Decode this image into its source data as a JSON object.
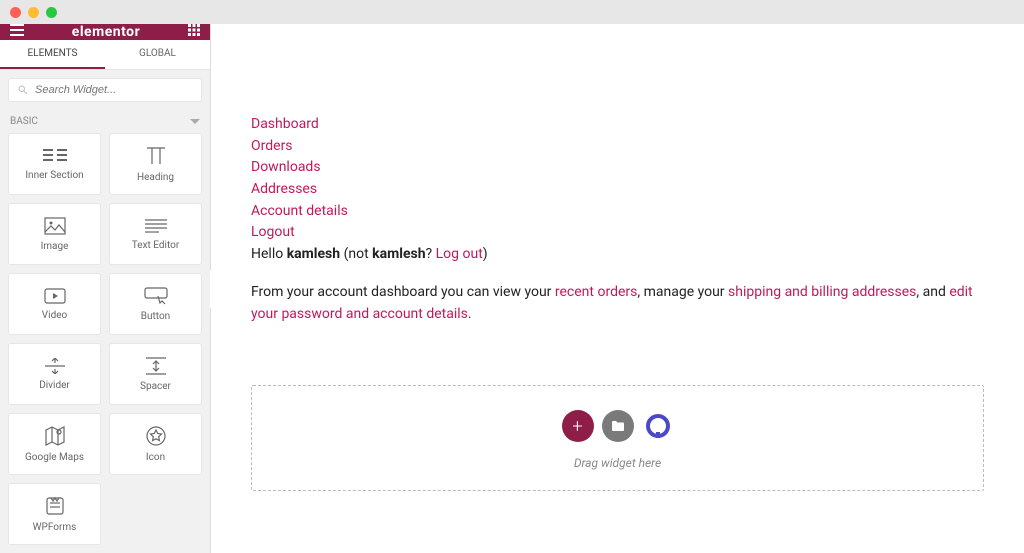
{
  "chrome": {},
  "sidebar": {
    "brand": "elementor",
    "tabs": {
      "elements": "ELEMENTS",
      "global": "GLOBAL"
    },
    "search_placeholder": "Search Widget...",
    "category": "BASIC",
    "widgets": [
      {
        "label": "Inner Section"
      },
      {
        "label": "Heading"
      },
      {
        "label": "Image"
      },
      {
        "label": "Text Editor"
      },
      {
        "label": "Video"
      },
      {
        "label": "Button"
      },
      {
        "label": "Divider"
      },
      {
        "label": "Spacer"
      },
      {
        "label": "Google Maps"
      },
      {
        "label": "Icon"
      },
      {
        "label": "WPForms"
      }
    ]
  },
  "account": {
    "nav": {
      "dashboard": "Dashboard",
      "orders": "Orders",
      "downloads": "Downloads",
      "addresses": "Addresses",
      "details": "Account details",
      "logout": "Logout"
    },
    "hello_prefix": "Hello ",
    "username": "kamlesh",
    "not_prefix": " (not ",
    "not_username": "kamlesh",
    "not_suffix": "? ",
    "logout_link": "Log out",
    "hello_close": ")",
    "dash_1": "From your account dashboard you can view your ",
    "link_recent": "recent orders",
    "dash_2": ", manage your ",
    "link_ship": "shipping and billing addresses",
    "dash_3": ", and ",
    "link_edit": "edit your password and account details",
    "dash_4": "."
  },
  "dropzone": {
    "hint": "Drag widget here"
  }
}
